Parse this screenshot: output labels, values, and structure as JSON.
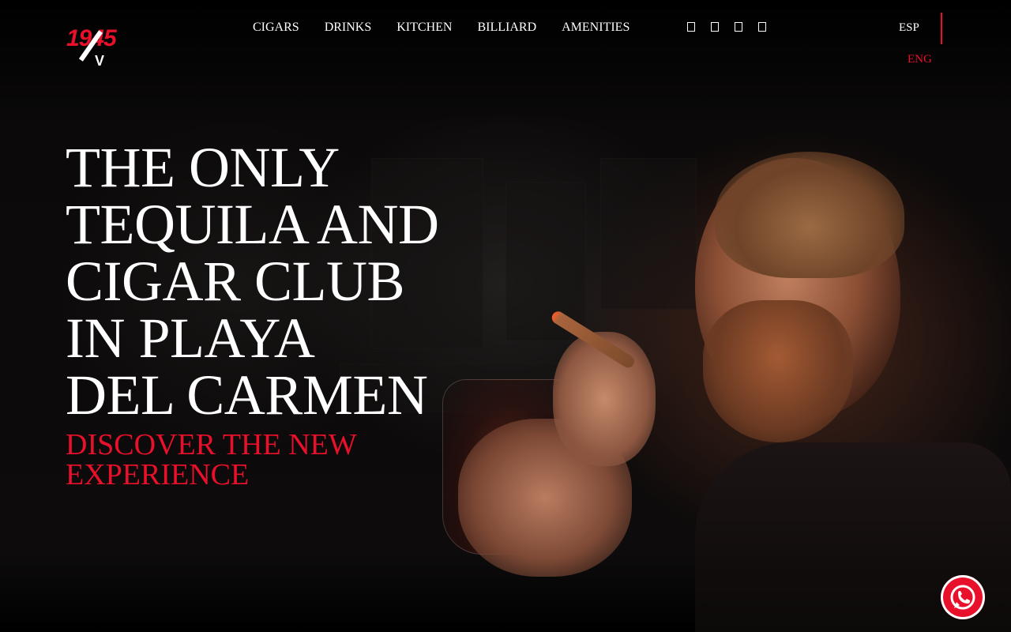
{
  "header": {
    "logo_text": "1945",
    "nav": [
      "CIGARS",
      "DRINKS",
      "KITCHEN",
      "BILLIARD",
      "AMENITIES"
    ],
    "social_icons": [
      "facebook-icon",
      "instagram-icon",
      "tripadvisor-icon",
      "youtube-icon"
    ],
    "languages": {
      "primary": "ESP",
      "secondary": "ENG"
    }
  },
  "hero": {
    "title": "THE ONLY\nTEQUILA AND\nCIGAR CLUB\nIN PLAYA\nDEL CARMEN",
    "subtitle": "DISCOVER THE NEW\nEXPERIENCE"
  },
  "floating": {
    "icon": "whatsapp-icon"
  },
  "colors": {
    "accent": "#e8102a",
    "background": "#000000",
    "text": "#ffffff"
  }
}
